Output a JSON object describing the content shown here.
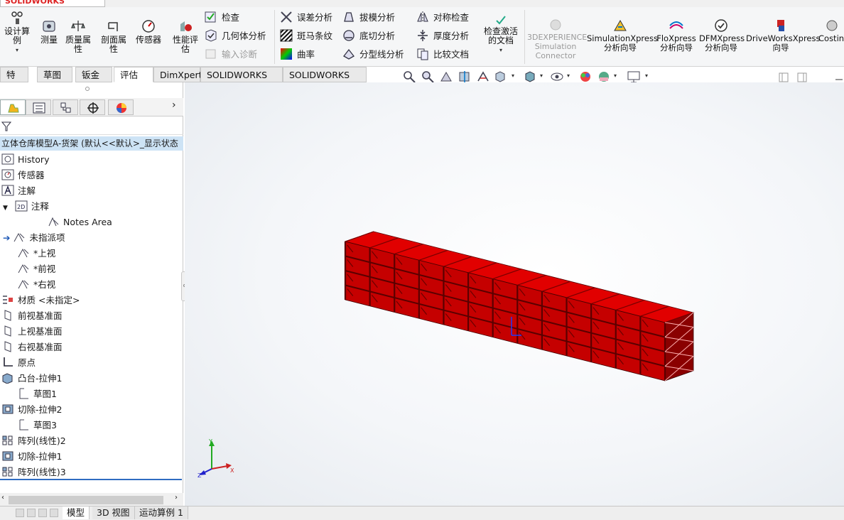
{
  "app": {
    "name": "SOLIDWORKS"
  },
  "ribbon": {
    "design_study": "设计算例",
    "measure": "测量",
    "mass_properties": "质量属性",
    "section_properties": "剖面属性",
    "sensors": "传感器",
    "performance_eval": "性能评估",
    "check": "检查",
    "geometry_analysis": "几何体分析",
    "import_diagnostics": "输入诊断",
    "deviation_analysis": "误差分析",
    "zebra_stripes": "斑马条纹",
    "curvature": "曲率",
    "draft_analysis": "拔模分析",
    "undercut_analysis": "底切分析",
    "parting_line_analysis": "分型线分析",
    "symmetry_check": "对称检查",
    "thickness_analysis": "厚度分析",
    "compare_documents": "比较文档",
    "check_active_doc": "检查激活的文档",
    "threedx_sim": "3DEXPERIENCE Simulation Connector",
    "simxpress": "SimulationXpress 分析向导",
    "floxpress": "FloXpress 分析向导",
    "dfmxpress": "DFMXpress 分析向导",
    "driveworks": "DriveWorksXpress 向导",
    "costing": "Costin"
  },
  "tabs": [
    "特征",
    "草图",
    "钣金",
    "评估",
    "DimXpert",
    "SOLIDWORKS 插件",
    "SOLIDWORKS MBD"
  ],
  "active_tab": "评估",
  "tree": {
    "root": "立体仓库模型A-货架 (默认<<默认>_显示状态",
    "items": [
      "History",
      "传感器",
      "注解",
      "注释",
      "Notes Area",
      "未指派项",
      "*上视",
      "*前视",
      "*右视",
      "材质 <未指定>",
      "前视基准面",
      "上视基准面",
      "右视基准面",
      "原点",
      "凸台-拉伸1",
      "草图1",
      "切除-拉伸2",
      "草图3",
      "阵列(线性)2",
      "切除-拉伸1",
      "阵列(线性)3"
    ]
  },
  "bottom_tabs": [
    "模型",
    "3D 视图",
    "运动算例 1"
  ],
  "triad": {
    "x": "X",
    "y": "Y",
    "z": "Z"
  },
  "colors": {
    "model": "#e10000",
    "model_dark": "#8a0000",
    "accent": "#2f6cc1"
  }
}
